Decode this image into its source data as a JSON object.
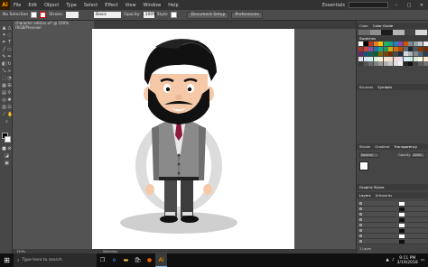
{
  "app": {
    "logo": "Ai",
    "menus": [
      "File",
      "Edit",
      "Object",
      "Type",
      "Select",
      "Effect",
      "View",
      "Window",
      "Help"
    ],
    "workspace": "Essentials"
  },
  "control_bar": {
    "selection": "No Selection",
    "stroke_label": "Stroke:",
    "brush_label": "Basic",
    "opacity_label": "Opacity:",
    "opacity_value": "100%",
    "style_label": "Style:",
    "doc_setup": "Document Setup",
    "preferences": "Preferences"
  },
  "document": {
    "tab_title": "character edition.ai* @ 150% (RGB/Preview)",
    "zoom": "150%",
    "status_tool": "Selection"
  },
  "panels": {
    "color_tabs": [
      "Color",
      "Color Guide"
    ],
    "swatches_tab": "Swatches",
    "brushes_tabs": [
      "Brushes",
      "Symbols"
    ],
    "transparency_tabs": [
      "Stroke",
      "Gradient",
      "Transparency"
    ],
    "transparency_mode": "Normal",
    "opacity_label": "Opacity:",
    "opacity_value": "100%",
    "graphic_styles_tabs": [
      "Graphic Styles"
    ],
    "layers_tabs": [
      "Layers",
      "Artboards"
    ],
    "layer_count": "1 Layer"
  },
  "taskbar": {
    "search_placeholder": "Type here to search",
    "time": "9:11 PM",
    "date": "3/19/2018"
  },
  "colors": {
    "app_bg": "#535353",
    "menubar": "#323232",
    "panel": "#454545",
    "accent_logo": "#ff9a00"
  }
}
